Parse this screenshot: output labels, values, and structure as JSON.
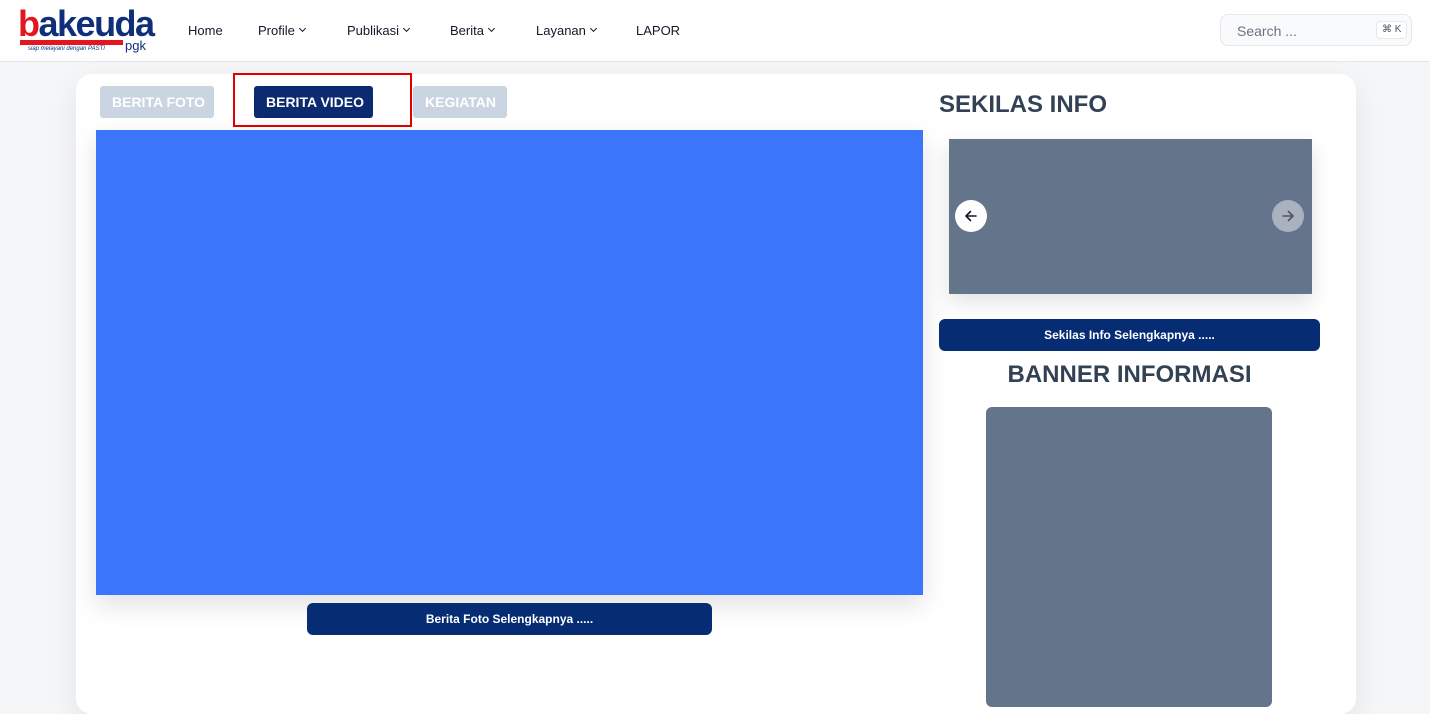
{
  "logo": {
    "brand_initial": "b",
    "brand_rest": "akeuda",
    "tagline": "siap melayani dengan PASTI",
    "sub": "pgk"
  },
  "nav": {
    "items": [
      {
        "label": "Home",
        "has_dropdown": false
      },
      {
        "label": "Profile",
        "has_dropdown": true
      },
      {
        "label": "Publikasi",
        "has_dropdown": true
      },
      {
        "label": "Berita",
        "has_dropdown": true
      },
      {
        "label": "Layanan",
        "has_dropdown": true
      },
      {
        "label": "LAPOR",
        "has_dropdown": false
      }
    ]
  },
  "search": {
    "placeholder": "Search ...",
    "shortcut": "⌘ K"
  },
  "tabs": [
    {
      "label": "BERITA FOTO",
      "active": false
    },
    {
      "label": "BERITA VIDEO",
      "active": true
    },
    {
      "label": "KEGIATAN",
      "active": false
    }
  ],
  "main": {
    "more_button": "Berita Foto Selengkapnya ....."
  },
  "sidebar": {
    "sekilas_title": "SEKILAS INFO",
    "sekilas_button": "Sekilas Info Selengkapnya .....",
    "banner_title": "BANNER INFORMASI",
    "slider_prev_icon": "arrow-left-icon",
    "slider_next_icon": "arrow-right-icon"
  },
  "colors": {
    "brand_red": "#e3161f",
    "brand_navy": "#0b2a6f",
    "video_placeholder": "#3b76fa",
    "image_placeholder": "#64748b",
    "highlight": "#e00000"
  }
}
